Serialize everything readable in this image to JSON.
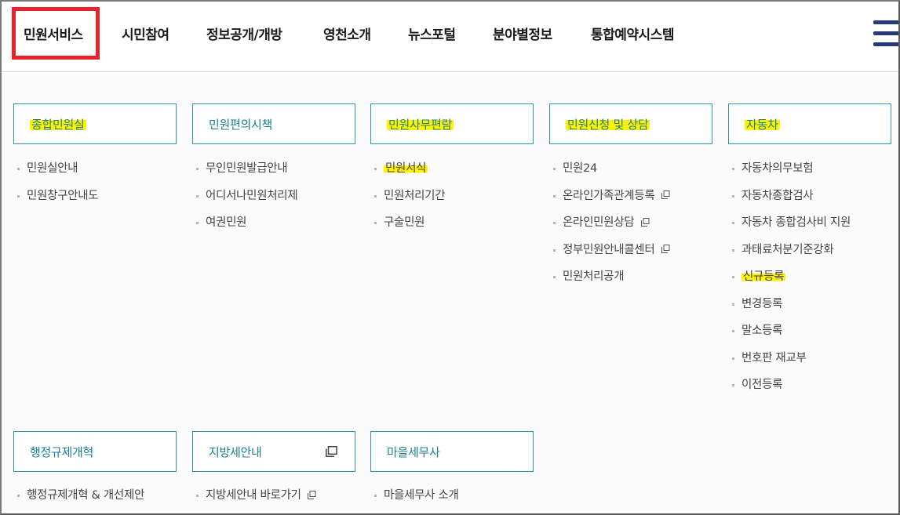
{
  "nav": {
    "items": [
      "민원서비스",
      "시민참여",
      "정보공개/개방",
      "영천소개",
      "뉴스포털",
      "분야별정보",
      "통합예약시스템"
    ],
    "active": "민원서비스",
    "menu_icon": "hamburger-icon"
  },
  "categories": [
    {
      "title": "종합민원실",
      "highlight": true,
      "items": [
        {
          "label": "민원실안내"
        },
        {
          "label": "민원창구안내도"
        }
      ]
    },
    {
      "title": "민원편의시책",
      "highlight": false,
      "items": [
        {
          "label": "무인민원발급안내"
        },
        {
          "label": "어디서나민원처리제"
        },
        {
          "label": "여권민원"
        }
      ]
    },
    {
      "title": "민원사무편람",
      "highlight": true,
      "items": [
        {
          "label": "민원서식",
          "highlight": true
        },
        {
          "label": "민원처리기간"
        },
        {
          "label": "구술민원"
        }
      ]
    },
    {
      "title": "민원신청 및 상담",
      "highlight": true,
      "items": [
        {
          "label": "민원24"
        },
        {
          "label": "온라인가족관계등록",
          "external": true
        },
        {
          "label": "온라인민원상담",
          "external": true
        },
        {
          "label": "정부민원안내콜센터",
          "external": true
        },
        {
          "label": "민원처리공개"
        }
      ]
    },
    {
      "title": "자동차",
      "highlight": true,
      "items": [
        {
          "label": "자동차의무보험"
        },
        {
          "label": "자동차종합검사"
        },
        {
          "label": "자동차 종합검사비 지원"
        },
        {
          "label": "과태료처분기준강화"
        },
        {
          "label": "신규등록",
          "highlight": true
        },
        {
          "label": "변경등록"
        },
        {
          "label": "말소등록"
        },
        {
          "label": "번호판 재교부"
        },
        {
          "label": "이전등록"
        }
      ]
    },
    {
      "title": "행정규제개혁",
      "highlight": false,
      "items": [
        {
          "label": "행정규제개혁 & 개선제안"
        }
      ]
    },
    {
      "title": "지방세안내",
      "highlight": false,
      "external": true,
      "items": [
        {
          "label": "지방세안내 바로가기",
          "external": true
        }
      ]
    },
    {
      "title": "마을세무사",
      "highlight": false,
      "items": [
        {
          "label": "마을세무사 소개"
        }
      ]
    }
  ],
  "colors": {
    "accent": "#2a98a8",
    "label": "#1d7f94",
    "highlight": "#fff200",
    "active_box": "#e8232c",
    "menu_icon": "#263a7a"
  }
}
